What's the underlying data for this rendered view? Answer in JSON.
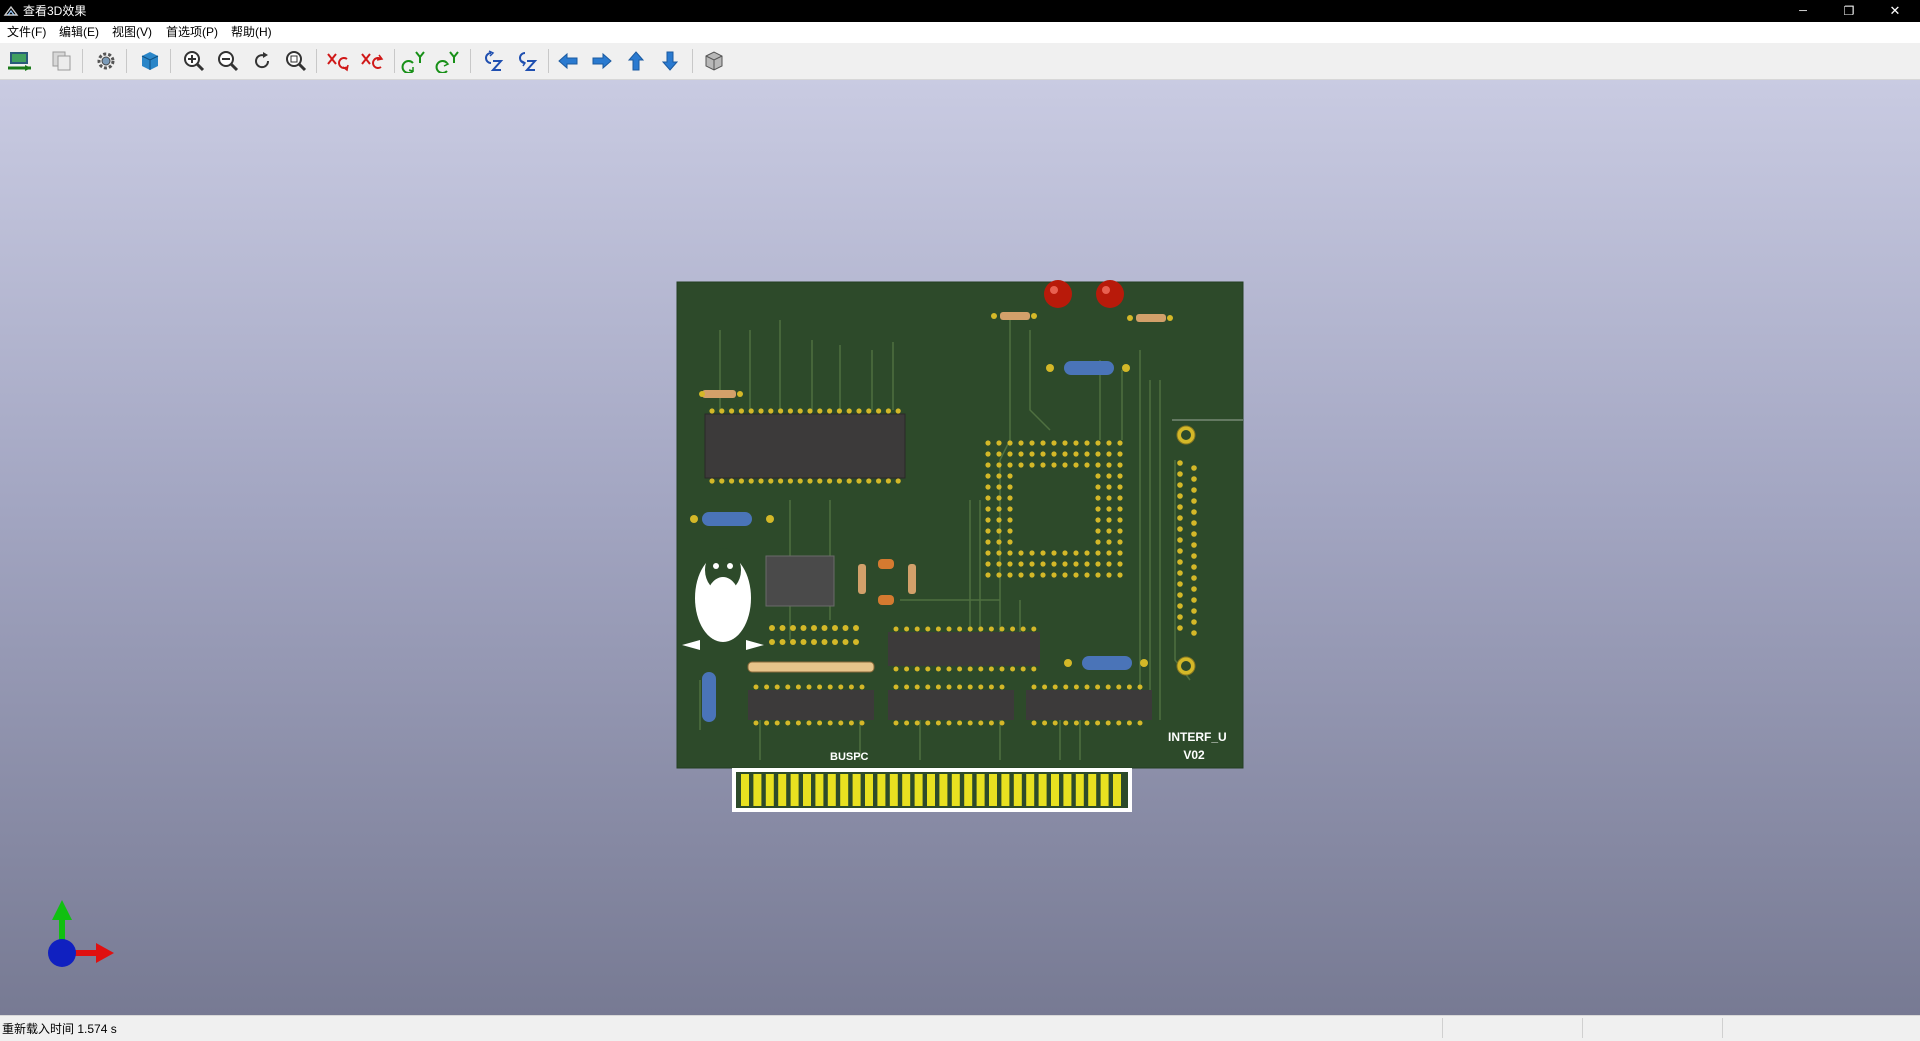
{
  "window": {
    "title": "查看3D效果",
    "controls": {
      "minimize": "─",
      "restore": "❐",
      "close": "✕"
    }
  },
  "menu": [
    {
      "label": "文件(F)"
    },
    {
      "label": "编辑(E)"
    },
    {
      "label": "视图(V)"
    },
    {
      "label": "首选项(P)"
    },
    {
      "label": "帮助(H)"
    }
  ],
  "toolbar": {
    "tools": [
      "reload-board-icon",
      "copy-image-icon",
      "settings-icon",
      "render-mode-icon",
      "zoom-in-icon",
      "zoom-out-icon",
      "redraw-icon",
      "zoom-fit-icon",
      "rotate-x-cw-icon",
      "rotate-x-ccw-icon",
      "rotate-y-cw-icon",
      "rotate-y-ccw-icon",
      "rotate-z-cw-icon",
      "rotate-z-ccw-icon",
      "move-left-icon",
      "move-right-icon",
      "move-up-icon",
      "move-down-icon",
      "orthographic-icon"
    ]
  },
  "board": {
    "brand_label": "INTERF_U",
    "version_label": "V02",
    "bus_label": "BUSPC",
    "colors": {
      "pcb": "#2d4a2a",
      "trace": "#4a6b3a",
      "pad": "#d4b828",
      "ic_body": "#3c3a3a",
      "edge_connector": "#e8e020",
      "led": "#b81a0a",
      "capacitor": "#4a74b8",
      "background_top": "#c9cbe2",
      "background_bottom": "#777a93"
    }
  },
  "axes": {
    "x_color": "#e01010",
    "y_color": "#10c010",
    "z_color": "#1020c0"
  },
  "status": {
    "message": "重新载入时间 1.574 s"
  }
}
